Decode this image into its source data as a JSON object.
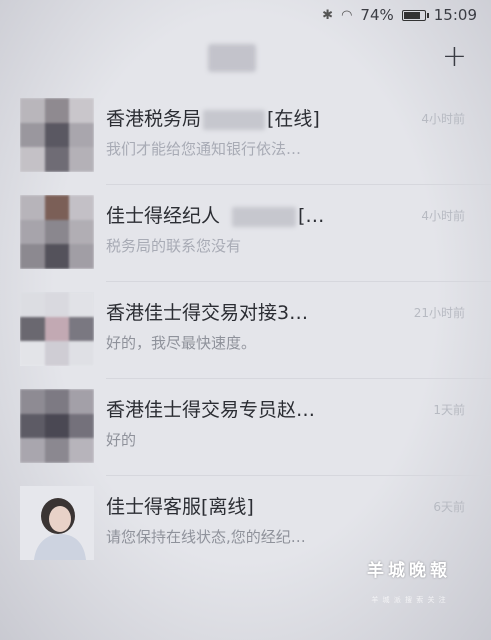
{
  "status_bar": {
    "battery": "74%",
    "time": "15:09"
  },
  "header": {
    "add_label": "+"
  },
  "conversations": [
    {
      "name": "香港税务局",
      "status": "[在线]",
      "preview": "我们才能给您通知银行依法…",
      "time": "4小时前"
    },
    {
      "name": "佳士得经纪人",
      "status": "[…",
      "preview": "税务局的联系您没有",
      "time": "4小时前"
    },
    {
      "name": "香港佳士得交易对接3…",
      "preview": "好的，我尽最快速度。",
      "time": "21小时前"
    },
    {
      "name": "香港佳士得交易专员赵…",
      "preview": "好的",
      "time": "1天前"
    },
    {
      "name": "佳士得客服[离线]",
      "preview": "请您保持在线状态,您的经纪…",
      "time": "6天前"
    }
  ],
  "watermark": {
    "title": "羊城晚報",
    "subtitle": "羊 城 派 搜 索 关 注"
  }
}
